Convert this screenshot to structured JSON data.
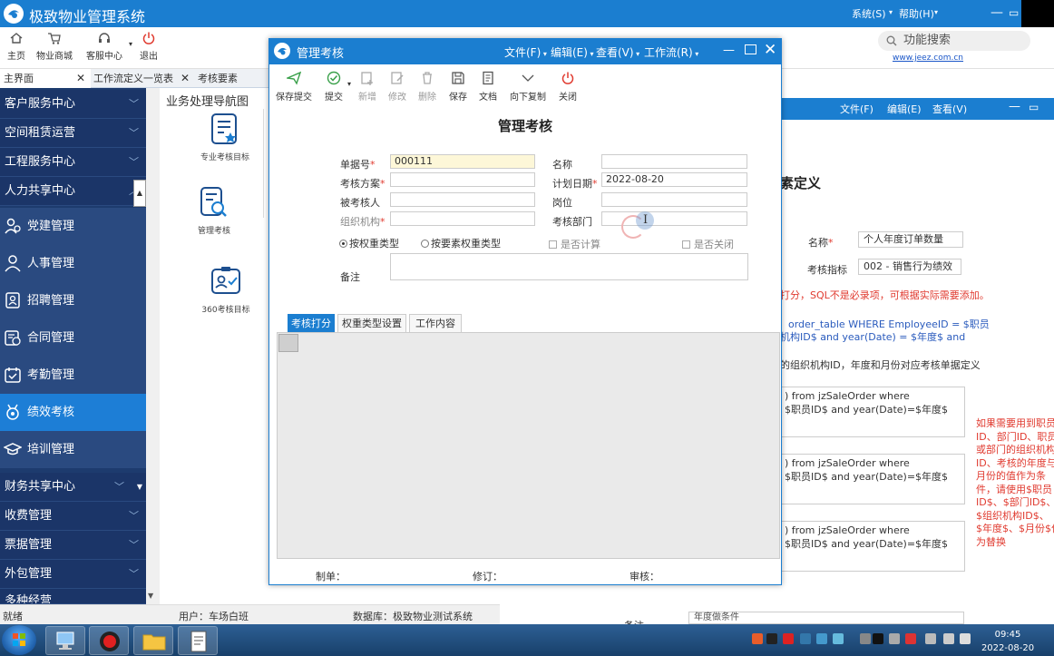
{
  "app": {
    "title": "极致物业管理系统",
    "menus": [
      "系统(S)",
      "帮助(H)"
    ]
  },
  "toolbar": {
    "buttons": [
      "主页",
      "物业商城",
      "客服中心",
      "退出"
    ],
    "search_placeholder": "功能搜索",
    "website": "www.jeez.com.cn"
  },
  "tabs": [
    "主界面",
    "工作流定义一览表",
    "考核要素"
  ],
  "sidebar": {
    "categories_top": [
      "客户服务中心",
      "空间租赁运营",
      "工程服务中心",
      "人力共享中心"
    ],
    "sub_items": [
      "党建管理",
      "人事管理",
      "招聘管理",
      "合同管理",
      "考勤管理",
      "绩效考核",
      "培训管理"
    ],
    "active_item": "绩效考核",
    "categories_bottom": [
      "财务共享中心",
      "收费管理",
      "票据管理",
      "外包管理",
      "多种经营"
    ]
  },
  "nav": {
    "title": "业务处理导航图",
    "items": [
      "专业考核目标",
      "管理考核",
      "360考核目标"
    ]
  },
  "background_window": {
    "menus": [
      "文件(F)",
      "编辑(E)",
      "查看(V)"
    ],
    "heading_fragment": "素定义",
    "name_label": "名称",
    "name_value": "个人年度订单数量",
    "indicator_label": "考核指标",
    "indicator_value": "002 - 销售行为绩效",
    "red_note": "打分，SQL不是必录项，可根据实际需要添加。",
    "blue_line1": "order_table WHERE EmployeeID = $职员",
    "blue_line2": "机构ID$ and year(Date) = $年度$ and",
    "desc_line": "的组织机构ID，年度和月份对应考核单据定义",
    "sql_lines": [
      ") from jzSaleOrder where",
      "$职员ID$ and year(Date)=$年度$"
    ],
    "side_note": [
      "如果需要用到职员",
      "ID、部门ID、职员",
      "或部门的组织机构",
      "ID、考核的年度与",
      "月份的值作为条",
      "件，请使用$职员",
      "ID$、$部门ID$、",
      "$组织机构ID$、",
      "$年度$、$月份$作",
      "为替换"
    ],
    "bottom_label": "备注",
    "bottom_input": "年度做条件"
  },
  "dialog": {
    "title": "管理考核",
    "menus": [
      "文件(F)",
      "编辑(E)",
      "查看(V)",
      "工作流(R)"
    ],
    "buttons": [
      "保存提交",
      "提交",
      "新增",
      "修改",
      "删除",
      "保存",
      "文档",
      "向下复制",
      "关闭"
    ],
    "heading": "管理考核",
    "fields": {
      "doc_no_label": "单据号",
      "doc_no_value": "000111",
      "name_label": "名称",
      "plan_label": "考核方案",
      "plan_date_label": "计划日期",
      "plan_date_value": "2022-08-20",
      "assessee_label": "被考核人",
      "position_label": "岗位",
      "org_label": "组织机构",
      "dept_label": "考核部门",
      "remark_label": "备注"
    },
    "radios": [
      "按权重类型",
      "按要素权重类型"
    ],
    "checkboxes": [
      "是否计算",
      "是否关闭"
    ],
    "tabs": [
      "考核打分",
      "权重类型设置",
      "工作内容"
    ],
    "footer": [
      "制单：",
      "修订：",
      "审核："
    ]
  },
  "status_bar": {
    "state": "就绪",
    "user": "用户：车场白班",
    "database": "数据库：极致物业测试系统"
  },
  "taskbar": {
    "time": "09:45",
    "date": "2022-08-20"
  }
}
